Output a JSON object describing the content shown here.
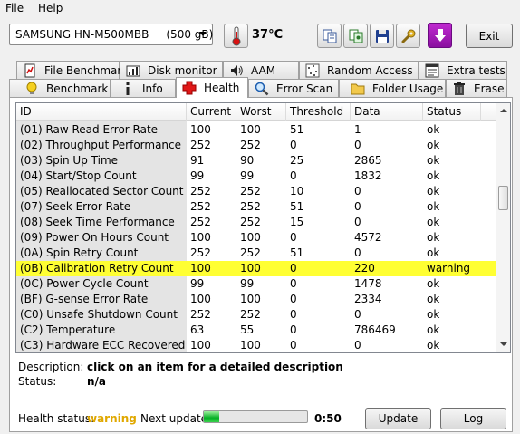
{
  "menu": {
    "file": "File",
    "help": "Help"
  },
  "toolbar": {
    "drive": "SAMSUNG HN-M500MBB     (500 gB)",
    "temperature": "37°C",
    "exit": "Exit"
  },
  "tabs_top": [
    {
      "label": "File Benchmark",
      "icon": "file-benchmark-icon"
    },
    {
      "label": "Disk monitor",
      "icon": "disk-monitor-icon"
    },
    {
      "label": "AAM",
      "icon": "speaker-icon"
    },
    {
      "label": "Random Access",
      "icon": "random-access-icon"
    },
    {
      "label": "Extra tests",
      "icon": "extra-tests-icon"
    }
  ],
  "tabs_bottom": [
    {
      "label": "Benchmark",
      "icon": "lightbulb-icon"
    },
    {
      "label": "Info",
      "icon": "info-icon"
    },
    {
      "label": "Health",
      "icon": "red-cross-icon",
      "active": true
    },
    {
      "label": "Error Scan",
      "icon": "magnifier-icon"
    },
    {
      "label": "Folder Usage",
      "icon": "folder-icon"
    },
    {
      "label": "Erase",
      "icon": "trash-icon"
    }
  ],
  "table": {
    "columns": [
      "ID",
      "Current",
      "Worst",
      "Threshold",
      "Data",
      "Status"
    ],
    "rows": [
      [
        "(01) Raw Read Error Rate",
        "100",
        "100",
        "51",
        "1",
        "ok"
      ],
      [
        "(02) Throughput Performance",
        "252",
        "252",
        "0",
        "0",
        "ok"
      ],
      [
        "(03) Spin Up Time",
        "91",
        "90",
        "25",
        "2865",
        "ok"
      ],
      [
        "(04) Start/Stop Count",
        "99",
        "99",
        "0",
        "1832",
        "ok"
      ],
      [
        "(05) Reallocated Sector Count",
        "252",
        "252",
        "10",
        "0",
        "ok"
      ],
      [
        "(07) Seek Error Rate",
        "252",
        "252",
        "51",
        "0",
        "ok"
      ],
      [
        "(08) Seek Time Performance",
        "252",
        "252",
        "15",
        "0",
        "ok"
      ],
      [
        "(09) Power On Hours Count",
        "100",
        "100",
        "0",
        "4572",
        "ok"
      ],
      [
        "(0A) Spin Retry Count",
        "252",
        "252",
        "51",
        "0",
        "ok"
      ],
      [
        "(0B) Calibration Retry Count",
        "100",
        "100",
        "0",
        "220",
        "warning"
      ],
      [
        "(0C) Power Cycle Count",
        "99",
        "99",
        "0",
        "1478",
        "ok"
      ],
      [
        "(BF) G-sense Error Rate",
        "100",
        "100",
        "0",
        "2334",
        "ok"
      ],
      [
        "(C0) Unsafe Shutdown Count",
        "252",
        "252",
        "0",
        "0",
        "ok"
      ],
      [
        "(C2) Temperature",
        "63",
        "55",
        "0",
        "786469",
        "ok"
      ],
      [
        "(C3) Hardware ECC Recovered",
        "100",
        "100",
        "0",
        "0",
        "ok"
      ]
    ],
    "highlight_color": "#ffff33"
  },
  "details": {
    "description_label": "Description:",
    "description_value": "click on an item for a detailed description",
    "status_label": "Status:",
    "status_value": "n/a"
  },
  "footer": {
    "health_label": "Health status:",
    "health_value": "warning",
    "health_color": "#e0a800",
    "next_update_label": "Next update:",
    "progress": 0.15,
    "countdown": "0:50",
    "update_button": "Update",
    "log_button": "Log"
  }
}
